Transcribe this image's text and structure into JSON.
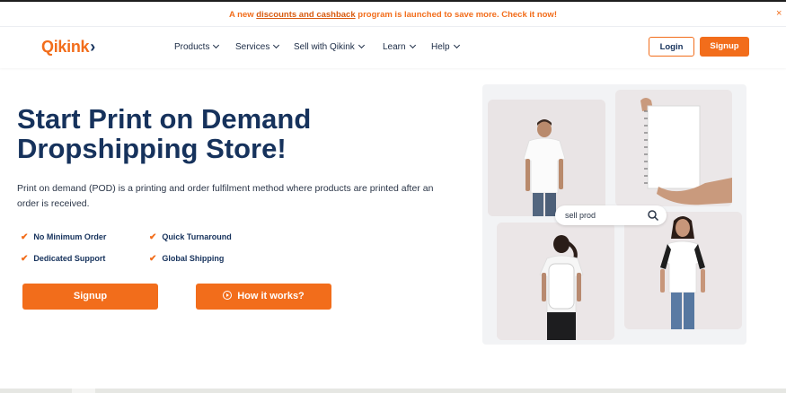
{
  "announcement": {
    "text_before": "A new ",
    "link": "discounts and cashback",
    "text_after": " program is launched to save more. Check it now!",
    "close": "×"
  },
  "nav": {
    "logo": "Qikink",
    "menu": [
      "Products",
      "Services",
      "Sell with Qikink",
      "Learn",
      "Help"
    ],
    "login": "Login",
    "signup": "Signup"
  },
  "hero": {
    "title_line1": "Start Print on Demand",
    "title_line2": "Dropshipping Store!",
    "description": "Print on demand (POD) is a printing and order fulfilment method where products are printed after an order is received.",
    "features": [
      "No Minimum Order",
      "Quick Turnaround",
      "Dedicated Support",
      "Global Shipping"
    ],
    "cta_signup": "Signup",
    "cta_how": "How it works?"
  },
  "gallery": {
    "search_text": "sell prod"
  },
  "colors": {
    "accent": "#f26d1b",
    "navy": "#16325c"
  }
}
